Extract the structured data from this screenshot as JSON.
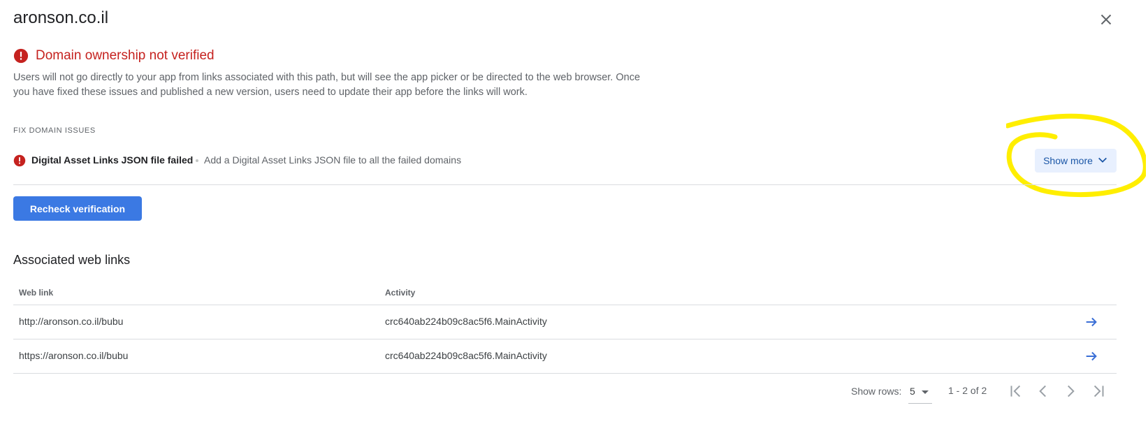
{
  "dialog": {
    "title": "aronson.co.il",
    "close_icon": "close-icon"
  },
  "alert": {
    "icon": "error-icon",
    "title": "Domain ownership not verified",
    "description": "Users will not go directly to your app from links associated with this path, but will see the app picker or be directed to the web browser. Once you have fixed these issues and published a new version, users need to update their app before the links will work.",
    "color": "#c5221f"
  },
  "fix_section": {
    "label": "FIX DOMAIN ISSUES",
    "issue": {
      "icon": "error-icon",
      "title": "Digital Asset Links JSON file failed",
      "description": "Add a Digital Asset Links JSON file to all the failed domains"
    },
    "show_more_label": "Show more",
    "show_more_icon": "chevron-down-icon",
    "annotation_color": "#ffee00"
  },
  "recheck_button": {
    "label": "Recheck verification",
    "color": "#3b79e3"
  },
  "web_links": {
    "title": "Associated web links",
    "columns": [
      "Web link",
      "Activity"
    ],
    "rows": [
      {
        "web_link": "http://aronson.co.il/bubu",
        "activity": "crc640ab224b09c8ac5f6.MainActivity"
      },
      {
        "web_link": "https://aronson.co.il/bubu",
        "activity": "crc640ab224b09c8ac5f6.MainActivity"
      }
    ],
    "row_action_icon": "arrow-right-icon"
  },
  "pagination": {
    "show_rows_label": "Show rows:",
    "rows_per_page": "5",
    "range_text": "1 - 2 of 2",
    "icons": [
      "first-page-icon",
      "previous-page-icon",
      "next-page-icon",
      "last-page-icon"
    ]
  }
}
